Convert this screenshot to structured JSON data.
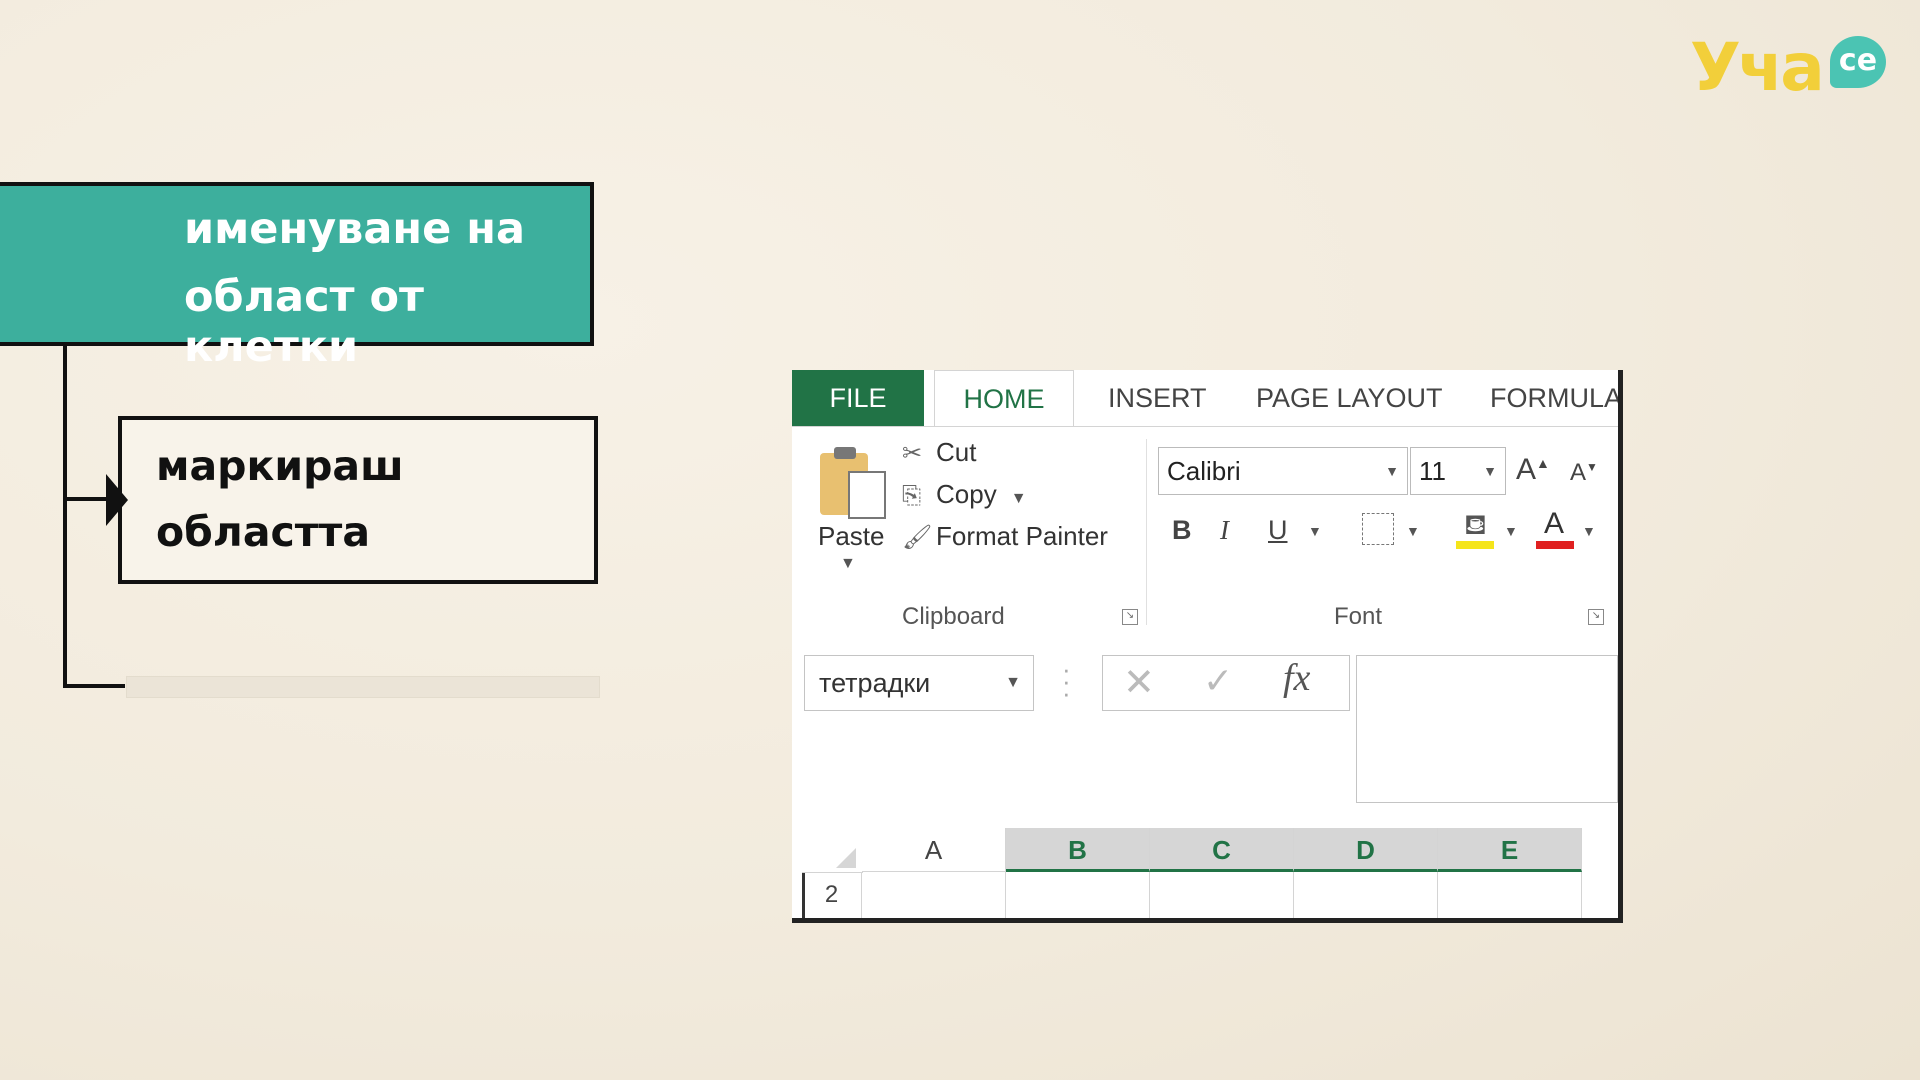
{
  "logo": {
    "word": "Уча",
    "badge": "се"
  },
  "mindmap": {
    "topic_lines": [
      "именуване на",
      "област от клетки"
    ],
    "sub_lines": [
      "маркираш",
      "областта"
    ]
  },
  "excel": {
    "tabs": {
      "file": "FILE",
      "home": "HOME",
      "insert": "INSERT",
      "page_layout": "PAGE LAYOUT",
      "formulas": "FORMULA"
    },
    "clipboard": {
      "paste": "Paste",
      "cut": "Cut",
      "copy": "Copy",
      "format_painter": "Format Painter",
      "group_label": "Clipboard"
    },
    "font": {
      "family": "Calibri",
      "size": "11",
      "bold": "B",
      "italic": "I",
      "underline": "U",
      "group_label": "Font"
    },
    "name_box": "тетрадки",
    "columns": [
      "A",
      "B",
      "C",
      "D",
      "E"
    ],
    "selected_columns": [
      "B",
      "C",
      "D",
      "E"
    ],
    "row_number": "2",
    "colors": {
      "accent": "#217346",
      "fill_yellow": "#f5e51b",
      "font_red": "#e02020"
    }
  },
  "colors": {
    "teal": "#3daf9d",
    "logo_yellow": "#f2cf3a",
    "logo_teal": "#4bc4b3"
  }
}
